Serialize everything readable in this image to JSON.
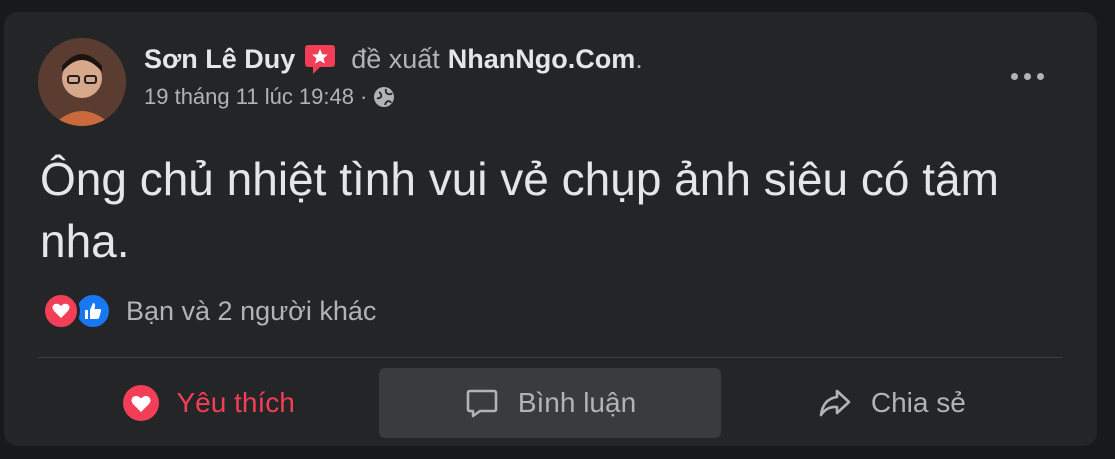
{
  "post": {
    "author": "Sơn Lê Duy",
    "recommend_text": "đề xuất",
    "page_name": "NhanNgo.Com",
    "page_name_suffix": ".",
    "timestamp": "19 tháng 11 lúc 19:48",
    "separator": "·",
    "privacy_icon": "globe-icon",
    "body": "Ông chủ nhiệt tình vui vẻ chụp ảnh siêu có tâm nha."
  },
  "reactions": {
    "icons": [
      "love-reaction-icon",
      "like-reaction-icon"
    ],
    "summary": "Bạn và 2 người khác"
  },
  "actions": {
    "like_label": "Yêu thích",
    "comment_label": "Bình luận",
    "share_label": "Chia sẻ"
  },
  "colors": {
    "background": "#18191a",
    "card": "#242526",
    "love": "#f33e58",
    "like": "#1877f2",
    "secondary_text": "#b0b3b8",
    "primary_text": "#e4e6eb"
  }
}
